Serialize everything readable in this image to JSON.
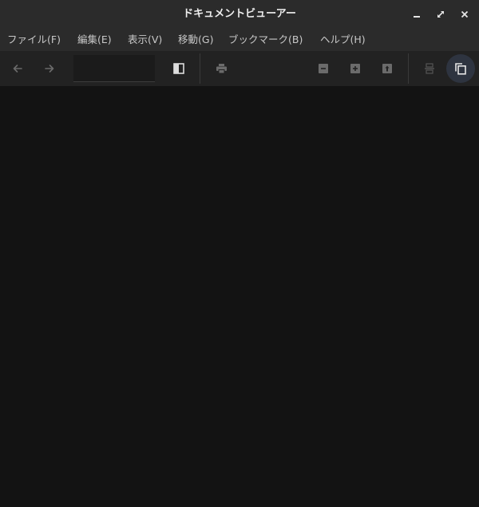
{
  "window": {
    "title": "ドキュメントビューアー",
    "controls": [
      "minimize-icon",
      "maximize-icon",
      "close-icon"
    ]
  },
  "menubar": {
    "items": [
      {
        "label": "ファイル(F)"
      },
      {
        "label": "編集(E)"
      },
      {
        "label": "表示(V)"
      },
      {
        "label": "移動(G)"
      },
      {
        "label": "ブックマーク(B)"
      },
      {
        "label": "ヘルプ(H)"
      }
    ]
  },
  "toolbar": {
    "back_icon": "arrow-left-icon",
    "forward_icon": "arrow-right-icon",
    "page_entry": {
      "value": "",
      "placeholder": ""
    },
    "sidebar_icon": "sidebar-toggle-icon",
    "print_icon": "printer-icon",
    "zoom_out_icon": "zoom-out-icon",
    "zoom_in_icon": "zoom-in-icon",
    "zoom_fit_icon": "zoom-fit-icon",
    "continuous_icon": "continuous-scroll-icon",
    "dual_page_icon": "dual-page-icon"
  },
  "colors": {
    "titlebar_bg": "#2b2b2b",
    "toolbar_bg": "#222222",
    "document_bg": "#131313",
    "icon_default": "#6b6b6b",
    "icon_bright": "#dddddd",
    "toggle_active_bg": "#2e3440"
  }
}
